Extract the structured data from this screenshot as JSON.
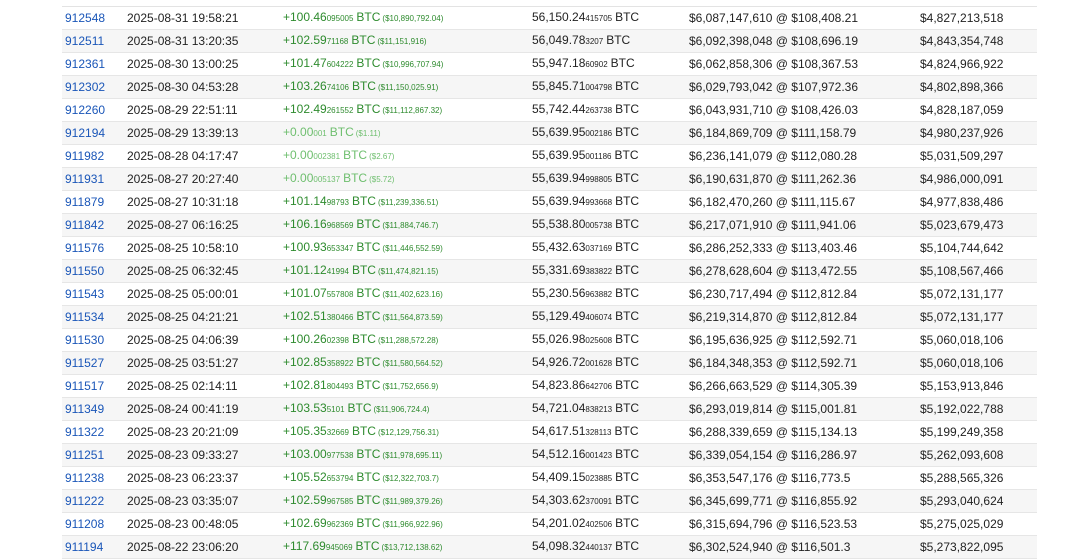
{
  "currency": "BTC",
  "rows": [
    {
      "block": "912548",
      "time": "2025-08-31 19:58:21",
      "amt_main": "+100.46",
      "amt_small": "095005",
      "amt_usd": "($10,890,792.04)",
      "bal_main": "56,150.24",
      "bal_small": "415705",
      "value": "$6,087,147,610 @ $108,408.21",
      "usd": "$4,827,213,518",
      "zero": false
    },
    {
      "block": "912511",
      "time": "2025-08-31 13:20:35",
      "amt_main": "+102.59",
      "amt_small": "71168",
      "amt_usd": "($11,151,916)",
      "bal_main": "56,049.78",
      "bal_small": "3207",
      "value": "$6,092,398,048 @ $108,696.19",
      "usd": "$4,843,354,748",
      "zero": false
    },
    {
      "block": "912361",
      "time": "2025-08-30 13:00:25",
      "amt_main": "+101.47",
      "amt_small": "604222",
      "amt_usd": "($10,996,707.94)",
      "bal_main": "55,947.18",
      "bal_small": "60902",
      "value": "$6,062,858,306 @ $108,367.53",
      "usd": "$4,824,966,922",
      "zero": false
    },
    {
      "block": "912302",
      "time": "2025-08-30 04:53:28",
      "amt_main": "+103.26",
      "amt_small": "74106",
      "amt_usd": "($11,150,025.91)",
      "bal_main": "55,845.71",
      "bal_small": "004798",
      "value": "$6,029,793,042 @ $107,972.36",
      "usd": "$4,802,898,366",
      "zero": false
    },
    {
      "block": "912260",
      "time": "2025-08-29 22:51:11",
      "amt_main": "+102.49",
      "amt_small": "261552",
      "amt_usd": "($11,112,867.32)",
      "bal_main": "55,742.44",
      "bal_small": "263738",
      "value": "$6,043,931,710 @ $108,426.03",
      "usd": "$4,828,187,059",
      "zero": false
    },
    {
      "block": "912194",
      "time": "2025-08-29 13:39:13",
      "amt_main": "+0.00",
      "amt_small": "001",
      "amt_usd": "($1.11)",
      "bal_main": "55,639.95",
      "bal_small": "002186",
      "value": "$6,184,869,709 @ $111,158.79",
      "usd": "$4,980,237,926",
      "zero": true
    },
    {
      "block": "911982",
      "time": "2025-08-28 04:17:47",
      "amt_main": "+0.00",
      "amt_small": "002381",
      "amt_usd": "($2.67)",
      "bal_main": "55,639.95",
      "bal_small": "001186",
      "value": "$6,236,141,079 @ $112,080.28",
      "usd": "$5,031,509,297",
      "zero": true
    },
    {
      "block": "911931",
      "time": "2025-08-27 20:27:40",
      "amt_main": "+0.00",
      "amt_small": "005137",
      "amt_usd": "($5.72)",
      "bal_main": "55,639.94",
      "bal_small": "998805",
      "value": "$6,190,631,870 @ $111,262.36",
      "usd": "$4,986,000,091",
      "zero": true
    },
    {
      "block": "911879",
      "time": "2025-08-27 10:31:18",
      "amt_main": "+101.14",
      "amt_small": "98793",
      "amt_usd": "($11,239,336.51)",
      "bal_main": "55,639.94",
      "bal_small": "993668",
      "value": "$6,182,470,260 @ $111,115.67",
      "usd": "$4,977,838,486",
      "zero": false
    },
    {
      "block": "911842",
      "time": "2025-08-27 06:16:25",
      "amt_main": "+106.16",
      "amt_small": "968569",
      "amt_usd": "($11,884,746.7)",
      "bal_main": "55,538.80",
      "bal_small": "005738",
      "value": "$6,217,071,910 @ $111,941.06",
      "usd": "$5,023,679,473",
      "zero": false
    },
    {
      "block": "911576",
      "time": "2025-08-25 10:58:10",
      "amt_main": "+100.93",
      "amt_small": "653347",
      "amt_usd": "($11,446,552.59)",
      "bal_main": "55,432.63",
      "bal_small": "037169",
      "value": "$6,286,252,333 @ $113,403.46",
      "usd": "$5,104,744,642",
      "zero": false
    },
    {
      "block": "911550",
      "time": "2025-08-25 06:32:45",
      "amt_main": "+101.12",
      "amt_small": "41994",
      "amt_usd": "($11,474,821.15)",
      "bal_main": "55,331.69",
      "bal_small": "383822",
      "value": "$6,278,628,604 @ $113,472.55",
      "usd": "$5,108,567,466",
      "zero": false
    },
    {
      "block": "911543",
      "time": "2025-08-25 05:00:01",
      "amt_main": "+101.07",
      "amt_small": "557808",
      "amt_usd": "($11,402,623.16)",
      "bal_main": "55,230.56",
      "bal_small": "963882",
      "value": "$6,230,717,494 @ $112,812.84",
      "usd": "$5,072,131,177",
      "zero": false
    },
    {
      "block": "911534",
      "time": "2025-08-25 04:21:21",
      "amt_main": "+102.51",
      "amt_small": "380466",
      "amt_usd": "($11,564,873.59)",
      "bal_main": "55,129.49",
      "bal_small": "406074",
      "value": "$6,219,314,870 @ $112,812.84",
      "usd": "$5,072,131,177",
      "zero": false
    },
    {
      "block": "911530",
      "time": "2025-08-25 04:06:39",
      "amt_main": "+100.26",
      "amt_small": "02398",
      "amt_usd": "($11,288,572.28)",
      "bal_main": "55,026.98",
      "bal_small": "025608",
      "value": "$6,195,636,925 @ $112,592.71",
      "usd": "$5,060,018,106",
      "zero": false
    },
    {
      "block": "911527",
      "time": "2025-08-25 03:51:27",
      "amt_main": "+102.85",
      "amt_small": "358922",
      "amt_usd": "($11,580,564.52)",
      "bal_main": "54,926.72",
      "bal_small": "001628",
      "value": "$6,184,348,353 @ $112,592.71",
      "usd": "$5,060,018,106",
      "zero": false
    },
    {
      "block": "911517",
      "time": "2025-08-25 02:14:11",
      "amt_main": "+102.81",
      "amt_small": "804493",
      "amt_usd": "($11,752,656.9)",
      "bal_main": "54,823.86",
      "bal_small": "642706",
      "value": "$6,266,663,529 @ $114,305.39",
      "usd": "$5,153,913,846",
      "zero": false
    },
    {
      "block": "911349",
      "time": "2025-08-24 00:41:19",
      "amt_main": "+103.53",
      "amt_small": "5101",
      "amt_usd": "($11,906,724.4)",
      "bal_main": "54,721.04",
      "bal_small": "838213",
      "value": "$6,293,019,814 @ $115,001.81",
      "usd": "$5,192,022,788",
      "zero": false
    },
    {
      "block": "911322",
      "time": "2025-08-23 20:21:09",
      "amt_main": "+105.35",
      "amt_small": "32669",
      "amt_usd": "($12,129,756.31)",
      "bal_main": "54,617.51",
      "bal_small": "328113",
      "value": "$6,288,339,659 @ $115,134.13",
      "usd": "$5,199,249,358",
      "zero": false
    },
    {
      "block": "911251",
      "time": "2025-08-23 09:33:27",
      "amt_main": "+103.00",
      "amt_small": "977538",
      "amt_usd": "($11,978,695.11)",
      "bal_main": "54,512.16",
      "bal_small": "001423",
      "value": "$6,339,054,154 @ $116,286.97",
      "usd": "$5,262,093,608",
      "zero": false
    },
    {
      "block": "911238",
      "time": "2025-08-23 06:23:37",
      "amt_main": "+105.52",
      "amt_small": "653794",
      "amt_usd": "($12,322,703.7)",
      "bal_main": "54,409.15",
      "bal_small": "023885",
      "value": "$6,353,547,176 @ $116,773.5",
      "usd": "$5,288,565,326",
      "zero": false
    },
    {
      "block": "911222",
      "time": "2025-08-23 03:35:07",
      "amt_main": "+102.59",
      "amt_small": "967585",
      "amt_usd": "($11,989,379.26)",
      "bal_main": "54,303.62",
      "bal_small": "370091",
      "value": "$6,345,699,771 @ $116,855.92",
      "usd": "$5,293,040,624",
      "zero": false
    },
    {
      "block": "911208",
      "time": "2025-08-23 00:48:05",
      "amt_main": "+102.69",
      "amt_small": "962369",
      "amt_usd": "($11,966,922.96)",
      "bal_main": "54,201.02",
      "bal_small": "402506",
      "value": "$6,315,694,796 @ $116,523.53",
      "usd": "$5,275,025,029",
      "zero": false
    },
    {
      "block": "911194",
      "time": "2025-08-22 23:06:20",
      "amt_main": "+117.69",
      "amt_small": "945069",
      "amt_usd": "($13,712,138.62)",
      "bal_main": "54,098.32",
      "bal_small": "440137",
      "value": "$6,302,524,940 @ $116,501.3",
      "usd": "$5,273,822,095",
      "zero": false
    }
  ]
}
